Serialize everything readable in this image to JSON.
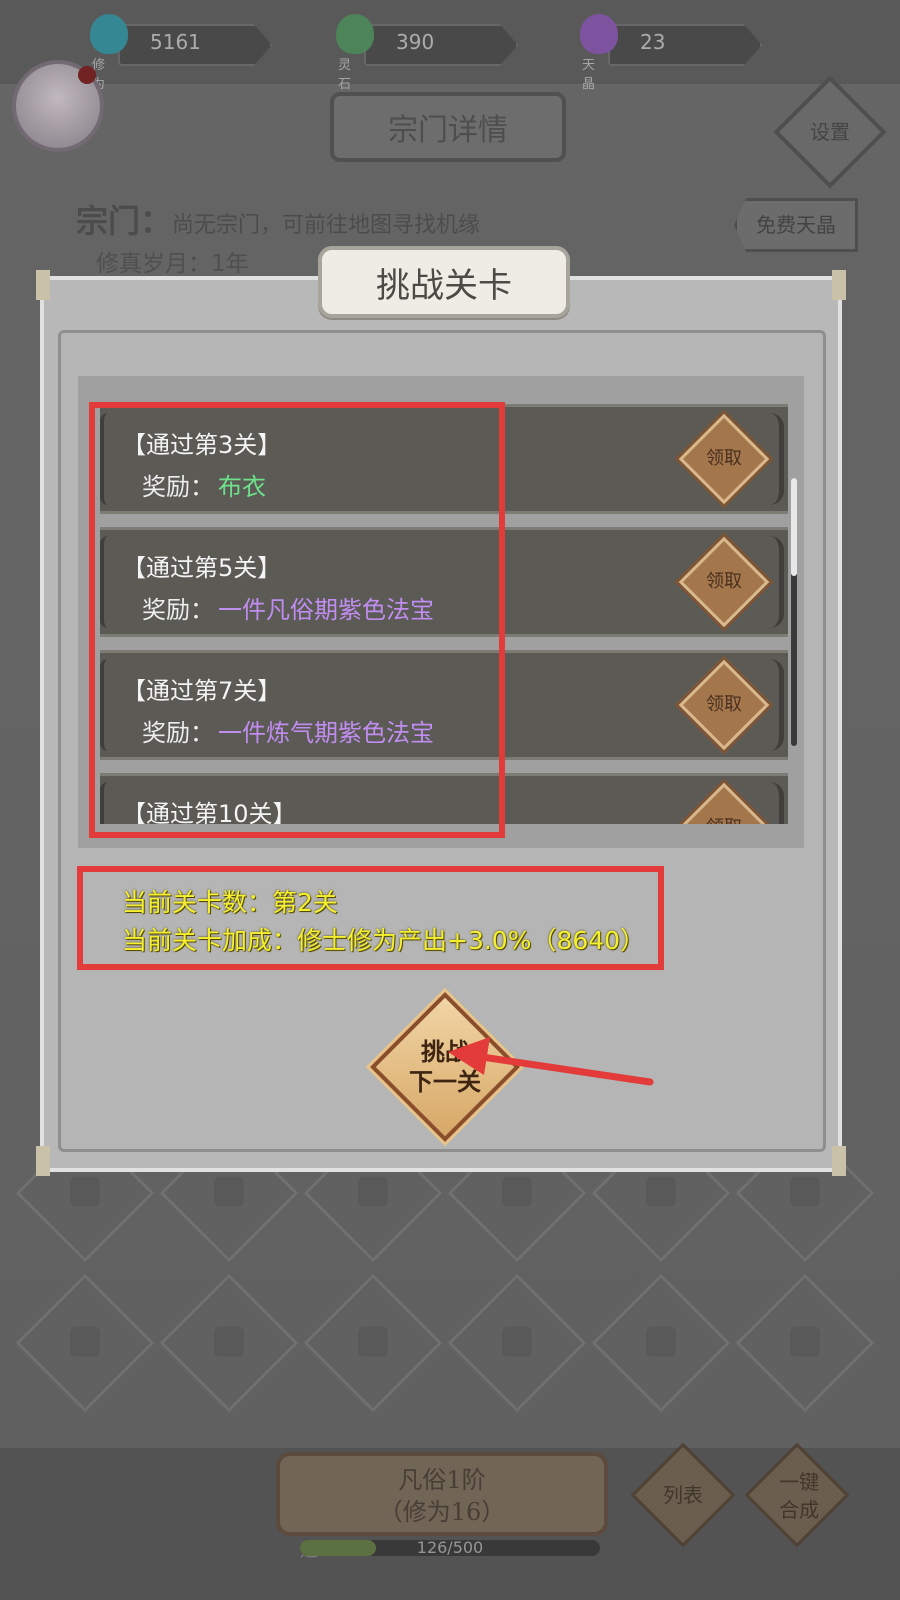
{
  "resources": [
    {
      "icon": "flame-icon",
      "value": "5161",
      "label": "修为",
      "color": "#3aa7b8"
    },
    {
      "icon": "crystal-icon",
      "value": "390",
      "label": "灵石",
      "color": "#5aa36a"
    },
    {
      "icon": "purple-gem-icon",
      "value": "23",
      "label": "天晶",
      "color": "#9a62c8"
    }
  ],
  "sect": {
    "title": "宗门详情",
    "settings_label": "设置",
    "sect_label": "宗门：",
    "sect_value": "尚无宗门，可前往地图寻找机缘",
    "years": "修真岁月：1年",
    "free_label": "免费天晶"
  },
  "modal": {
    "title": "挑战关卡",
    "rewards": [
      {
        "title": "【通过第3关】",
        "reward_label": "奖励：",
        "reward": "布衣",
        "reward_color": "#6ee08a",
        "claim_label": "领取"
      },
      {
        "title": "【通过第5关】",
        "reward_label": "奖励：",
        "reward": "一件凡俗期紫色法宝",
        "reward_color": "#c08df0",
        "claim_label": "领取"
      },
      {
        "title": "【通过第7关】",
        "reward_label": "奖励：",
        "reward": "一件炼气期紫色法宝",
        "reward_color": "#c08df0",
        "claim_label": "领取"
      },
      {
        "title": "【通过第10关】",
        "reward_label": "",
        "reward": "",
        "reward_color": "#c08df0",
        "claim_label": "领取"
      }
    ],
    "current_stage": "当前关卡数：第2关",
    "current_bonus": "当前关卡加成：修士修为产出+3.0%（8640）",
    "challenge_line1": "挑战",
    "challenge_line2": "下一关"
  },
  "bottom": {
    "rank_line1": "凡俗1阶",
    "rank_line2": "（修为16）",
    "list_label": "列表",
    "merge_line1": "一键",
    "merge_line2": "合成",
    "exp_label": "运",
    "exp_text": "126/500",
    "exp_fraction": 0.252
  },
  "colors": {
    "highlight": "#e33a3a",
    "info_text": "#f4ef30"
  }
}
